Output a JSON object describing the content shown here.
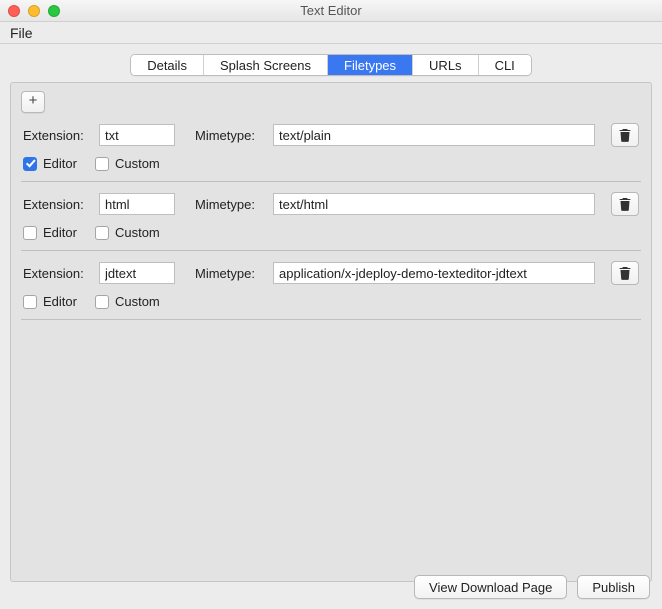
{
  "window": {
    "title": "Text Editor"
  },
  "menubar": {
    "file": "File"
  },
  "tabs": {
    "details": "Details",
    "splash": "Splash Screens",
    "filetypes": "Filetypes",
    "urls": "URLs",
    "cli": "CLI",
    "selected": "filetypes"
  },
  "labels": {
    "extension": "Extension:",
    "mimetype": "Mimetype:",
    "editor": "Editor",
    "custom": "Custom",
    "add": "+"
  },
  "buttons": {
    "view_download": "View Download Page",
    "publish": "Publish"
  },
  "filetypes": [
    {
      "extension": "txt",
      "mimetype": "text/plain",
      "editor": true,
      "custom": false
    },
    {
      "extension": "html",
      "mimetype": "text/html",
      "editor": false,
      "custom": false
    },
    {
      "extension": "jdtext",
      "mimetype": "application/x-jdeploy-demo-texteditor-jdtext",
      "editor": false,
      "custom": false
    }
  ]
}
